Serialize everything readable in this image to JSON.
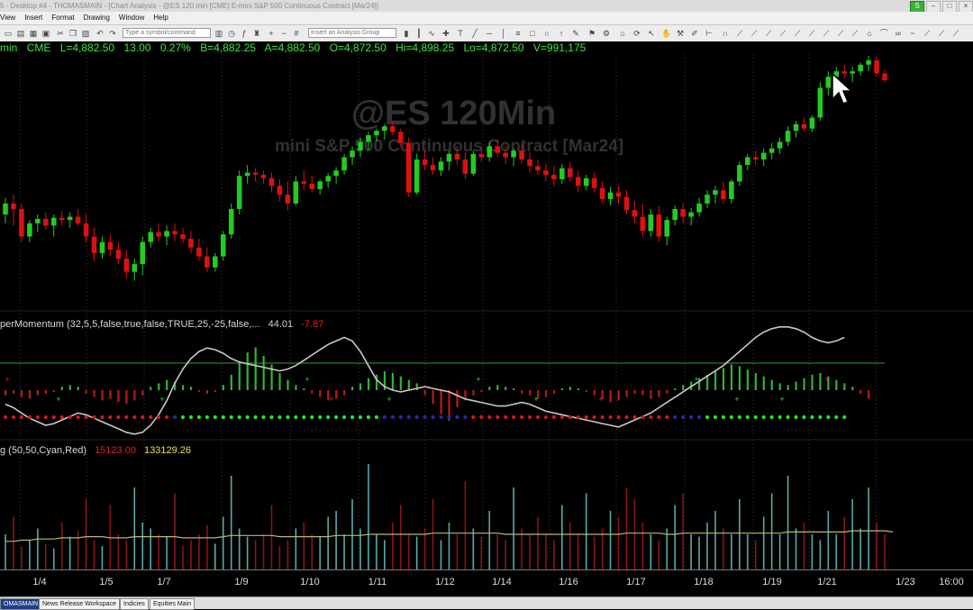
{
  "window": {
    "title": "5 - Desktop #4 - THOMASMAIN - [Chart Analysis - @ES 120 min [CME] E-mini S&P 500 Continuous Contract [Mar24]]",
    "buttons": [
      "S",
      "–",
      "□",
      "×"
    ]
  },
  "menu": [
    "View",
    "Insert",
    "Format",
    "Drawing",
    "Window",
    "Help"
  ],
  "toolbar": {
    "symbol_placeholder": "Type a symbol/command",
    "analysis_placeholder": "Insert an Analysis Group"
  },
  "quote": {
    "interval": "min",
    "exchange": "CME",
    "last": "L=4,882.50",
    "change": "13.00",
    "pct": "0.27%",
    "bid": "B=4,882.25",
    "ask": "A=4,882.50",
    "open": "O=4,872.50",
    "high": "Hi=4,898.25",
    "low": "Lo=4,872.50",
    "volume": "V=991,175"
  },
  "watermark": {
    "symbol": "@ES 120Min",
    "description": "mini S&P 500 Continuous Contract [Mar24]"
  },
  "indicator1": {
    "name": "perMomentum (32,5,5,false,true,false,TRUE,25,-25,false,...",
    "value1": "44.01",
    "value2": "-7.87"
  },
  "indicator2": {
    "name": "g (50,50,Cyan,Red)",
    "value1": "15123.00",
    "value2": "133129.26"
  },
  "axis": {
    "labels": [
      "1/4",
      "1/5",
      "1/7",
      "1/9",
      "1/10",
      "1/11",
      "1/12",
      "1/14",
      "1/16",
      "1/17",
      "1/18",
      "1/19",
      "1/21",
      "1/23",
      "16:00"
    ]
  },
  "tabs": [
    "OMASMAIN",
    "News Release Workspace",
    "Indicies",
    "Equities Main"
  ],
  "colors": {
    "up": "#22cc22",
    "down": "#dd1111",
    "quote": "#3ce63c",
    "momentum_line": "#c8c8c8",
    "vol_cyan": "#5aa8a8",
    "vol_red": "#8a1414",
    "vol_avg": "#b8b870",
    "value_red": "#e02020",
    "value_yellow": "#e6e64a"
  },
  "chart_data": {
    "type": "candlestick",
    "y_range": [
      4693,
      4904
    ],
    "ohlc": [
      [
        4760,
        4775,
        4752,
        4770
      ],
      [
        4770,
        4778,
        4750,
        4765
      ],
      [
        4765,
        4770,
        4735,
        4740
      ],
      [
        4740,
        4755,
        4735,
        4752
      ],
      [
        4752,
        4760,
        4744,
        4756
      ],
      [
        4756,
        4762,
        4746,
        4750
      ],
      [
        4750,
        4760,
        4740,
        4757
      ],
      [
        4757,
        4763,
        4750,
        4755
      ],
      [
        4755,
        4762,
        4748,
        4758
      ],
      [
        4758,
        4765,
        4750,
        4752
      ],
      [
        4752,
        4760,
        4735,
        4740
      ],
      [
        4740,
        4748,
        4718,
        4725
      ],
      [
        4725,
        4740,
        4720,
        4735
      ],
      [
        4735,
        4742,
        4722,
        4728
      ],
      [
        4728,
        4735,
        4715,
        4720
      ],
      [
        4720,
        4728,
        4702,
        4708
      ],
      [
        4708,
        4720,
        4700,
        4715
      ],
      [
        4715,
        4740,
        4705,
        4735
      ],
      [
        4735,
        4748,
        4730,
        4744
      ],
      [
        4744,
        4752,
        4736,
        4740
      ],
      [
        4740,
        4750,
        4732,
        4745
      ],
      [
        4745,
        4752,
        4736,
        4742
      ],
      [
        4742,
        4748,
        4734,
        4738
      ],
      [
        4738,
        4745,
        4725,
        4730
      ],
      [
        4730,
        4738,
        4718,
        4722
      ],
      [
        4722,
        4730,
        4708,
        4712
      ],
      [
        4712,
        4725,
        4708,
        4722
      ],
      [
        4722,
        4745,
        4718,
        4742
      ],
      [
        4742,
        4770,
        4738,
        4765
      ],
      [
        4765,
        4800,
        4760,
        4795
      ],
      [
        4795,
        4805,
        4788,
        4798
      ],
      [
        4798,
        4802,
        4790,
        4796
      ],
      [
        4796,
        4800,
        4788,
        4793
      ],
      [
        4793,
        4798,
        4780,
        4786
      ],
      [
        4786,
        4792,
        4772,
        4778
      ],
      [
        4778,
        4790,
        4764,
        4770
      ],
      [
        4770,
        4795,
        4768,
        4790
      ],
      [
        4790,
        4800,
        4782,
        4788
      ],
      [
        4788,
        4795,
        4780,
        4783
      ],
      [
        4783,
        4792,
        4778,
        4790
      ],
      [
        4790,
        4798,
        4784,
        4795
      ],
      [
        4795,
        4803,
        4788,
        4800
      ],
      [
        4800,
        4815,
        4796,
        4812
      ],
      [
        4812,
        4822,
        4805,
        4818
      ],
      [
        4818,
        4830,
        4812,
        4826
      ],
      [
        4826,
        4835,
        4818,
        4832
      ],
      [
        4832,
        4838,
        4826,
        4836
      ],
      [
        4836,
        4842,
        4828,
        4840
      ],
      [
        4840,
        4845,
        4832,
        4835
      ],
      [
        4835,
        4838,
        4822,
        4825
      ],
      [
        4825,
        4830,
        4776,
        4780
      ],
      [
        4780,
        4815,
        4778,
        4810
      ],
      [
        4810,
        4818,
        4800,
        4805
      ],
      [
        4805,
        4812,
        4796,
        4800
      ],
      [
        4800,
        4812,
        4795,
        4808
      ],
      [
        4808,
        4818,
        4800,
        4815
      ],
      [
        4815,
        4822,
        4805,
        4810
      ],
      [
        4810,
        4816,
        4792,
        4797
      ],
      [
        4797,
        4818,
        4795,
        4815
      ],
      [
        4815,
        4822,
        4808,
        4812
      ],
      [
        4812,
        4826,
        4808,
        4822
      ],
      [
        4822,
        4828,
        4812,
        4816
      ],
      [
        4816,
        4822,
        4806,
        4812
      ],
      [
        4812,
        4820,
        4804,
        4818
      ],
      [
        4818,
        4824,
        4806,
        4810
      ],
      [
        4810,
        4816,
        4798,
        4804
      ],
      [
        4804,
        4810,
        4796,
        4800
      ],
      [
        4800,
        4806,
        4790,
        4796
      ],
      [
        4796,
        4804,
        4785,
        4792
      ],
      [
        4792,
        4806,
        4788,
        4802
      ],
      [
        4802,
        4808,
        4790,
        4794
      ],
      [
        4794,
        4800,
        4780,
        4786
      ],
      [
        4786,
        4796,
        4782,
        4793
      ],
      [
        4793,
        4798,
        4780,
        4784
      ],
      [
        4784,
        4790,
        4770,
        4774
      ],
      [
        4774,
        4785,
        4768,
        4780
      ],
      [
        4780,
        4786,
        4770,
        4776
      ],
      [
        4776,
        4782,
        4760,
        4764
      ],
      [
        4764,
        4772,
        4752,
        4758
      ],
      [
        4758,
        4770,
        4740,
        4745
      ],
      [
        4745,
        4765,
        4740,
        4760
      ],
      [
        4760,
        4768,
        4735,
        4740
      ],
      [
        4740,
        4758,
        4732,
        4755
      ],
      [
        4755,
        4768,
        4750,
        4765
      ],
      [
        4765,
        4770,
        4752,
        4758
      ],
      [
        4758,
        4766,
        4750,
        4762
      ],
      [
        4762,
        4775,
        4758,
        4770
      ],
      [
        4770,
        4782,
        4766,
        4778
      ],
      [
        4778,
        4786,
        4770,
        4782
      ],
      [
        4782,
        4790,
        4770,
        4774
      ],
      [
        4774,
        4792,
        4770,
        4790
      ],
      [
        4790,
        4808,
        4786,
        4805
      ],
      [
        4805,
        4815,
        4800,
        4812
      ],
      [
        4812,
        4818,
        4805,
        4810
      ],
      [
        4810,
        4820,
        4804,
        4816
      ],
      [
        4816,
        4825,
        4810,
        4820
      ],
      [
        4820,
        4830,
        4815,
        4826
      ],
      [
        4826,
        4840,
        4822,
        4836
      ],
      [
        4836,
        4845,
        4830,
        4842
      ],
      [
        4842,
        4848,
        4835,
        4838
      ],
      [
        4838,
        4850,
        4835,
        4848
      ],
      [
        4848,
        4880,
        4845,
        4875
      ],
      [
        4875,
        4890,
        4868,
        4885
      ],
      [
        4885,
        4894,
        4878,
        4890
      ],
      [
        4890,
        4896,
        4884,
        4888
      ],
      [
        4888,
        4894,
        4880,
        4890
      ],
      [
        4890,
        4898,
        4886,
        4896
      ],
      [
        4896,
        4904,
        4890,
        4900
      ],
      [
        4900,
        4903,
        4885,
        4888
      ],
      [
        4888,
        4892,
        4880,
        4882
      ]
    ],
    "momentum_histogram": [
      -3,
      -2,
      -4,
      -5,
      -3,
      -2,
      -1,
      2,
      3,
      2,
      -2,
      -4,
      -6,
      -5,
      -7,
      -8,
      -6,
      -3,
      2,
      4,
      6,
      5,
      3,
      2,
      -1,
      -2,
      -1,
      3,
      9,
      16,
      22,
      25,
      20,
      15,
      10,
      6,
      3,
      1,
      -2,
      -4,
      -6,
      -5,
      -3,
      2,
      4,
      7,
      9,
      11,
      10,
      8,
      6,
      4,
      -3,
      -8,
      -14,
      -18,
      -10,
      -6,
      -3,
      -1,
      2,
      3,
      2,
      1,
      -2,
      -3,
      -5,
      -4,
      -2,
      1,
      2,
      1,
      -1,
      -3,
      -5,
      -7,
      -6,
      -4,
      -2,
      -3,
      -5,
      -4,
      -2,
      1,
      3,
      5,
      7,
      9,
      11,
      13,
      15,
      14,
      12,
      10,
      8,
      6,
      4,
      3,
      5,
      7,
      9,
      10,
      8,
      6,
      4,
      2,
      -2,
      -5
    ],
    "momentum_line": [
      -8,
      -10,
      -13,
      -16,
      -18,
      -20,
      -19,
      -17,
      -15,
      -13,
      -14,
      -16,
      -18,
      -20,
      -22,
      -24,
      -25,
      -24,
      -20,
      -14,
      -6,
      4,
      12,
      18,
      22,
      24,
      23,
      21,
      18,
      16,
      15,
      14,
      13,
      12,
      11,
      12,
      14,
      17,
      20,
      23,
      26,
      28,
      30,
      28,
      22,
      14,
      6,
      2,
      0,
      -1,
      0,
      1,
      2,
      1,
      0,
      -1,
      -3,
      -5,
      -6,
      -7,
      -8,
      -9,
      -9,
      -8,
      -7,
      -8,
      -10,
      -12,
      -13,
      -14,
      -15,
      -16,
      -17,
      -18,
      -19,
      -20,
      -21,
      -19,
      -17,
      -15,
      -13,
      -10,
      -7,
      -4,
      -1,
      2,
      5,
      8,
      11,
      14,
      18,
      22,
      26,
      30,
      33,
      35,
      36,
      36,
      35,
      33,
      30,
      28,
      27,
      28,
      30
    ],
    "volume": [
      30,
      45,
      20,
      25,
      35,
      22,
      18,
      40,
      28,
      33,
      60,
      25,
      20,
      55,
      30,
      25,
      70,
      40,
      35,
      30,
      28,
      65,
      20,
      25,
      30,
      38,
      22,
      45,
      80,
      35,
      28,
      25,
      30,
      55,
      20,
      25,
      35,
      40,
      30,
      28,
      45,
      50,
      30,
      60,
      35,
      90,
      30,
      25,
      40,
      55,
      30,
      28,
      35,
      60,
      25,
      40,
      30,
      75,
      35,
      28,
      50,
      30,
      25,
      70,
      35,
      30,
      45,
      30,
      25,
      55,
      40,
      30,
      65,
      28,
      35,
      50,
      45,
      70,
      60,
      40,
      30,
      25,
      35,
      55,
      65,
      30,
      28,
      40,
      50,
      35,
      30,
      60,
      30,
      25,
      45,
      65,
      30,
      80,
      35,
      40,
      30,
      25,
      50,
      30,
      45,
      60,
      35,
      70,
      40,
      30
    ],
    "volume_avg": [
      24,
      24,
      25,
      25,
      26,
      26,
      26,
      27,
      27,
      27,
      28,
      28,
      28,
      27,
      27,
      27,
      28,
      28,
      28,
      28,
      28,
      28,
      27,
      27,
      27,
      27,
      27,
      28,
      29,
      29,
      29,
      29,
      29,
      29,
      28,
      28,
      28,
      28,
      28,
      28,
      28,
      29,
      29,
      29,
      29,
      30,
      30,
      30,
      30,
      30,
      30,
      30,
      30,
      31,
      31,
      31,
      31,
      31,
      31,
      31,
      31,
      31,
      30,
      30,
      30,
      30,
      30,
      30,
      30,
      30,
      30,
      30,
      30,
      30,
      30,
      30,
      30,
      31,
      31,
      31,
      31,
      31,
      30,
      30,
      31,
      31,
      31,
      31,
      31,
      31,
      31,
      31,
      31,
      31,
      31,
      31,
      31,
      32,
      32,
      32,
      32,
      32,
      32,
      32,
      32,
      33,
      33,
      33,
      33,
      33,
      32
    ]
  }
}
